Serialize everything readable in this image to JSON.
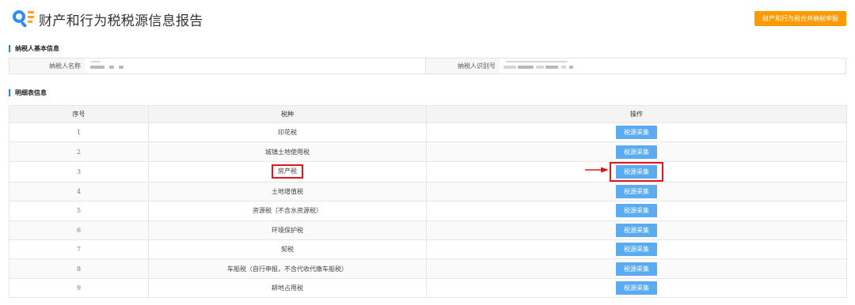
{
  "header": {
    "title": "财产和行为税税源信息报告",
    "combined_button_label": "财产和行为税合并纳税申报",
    "colors": {
      "accent_orange": "#ff9a00",
      "logo_blue": "#2b8ef0",
      "logo_orange": "#ffa21a"
    }
  },
  "basic_info": {
    "section_title": "纳税人基本信息",
    "name_label": "纳税人名称",
    "id_label": "纳税人识别号"
  },
  "detail": {
    "section_title": "明细表信息",
    "columns": [
      "序号",
      "税种",
      "操作"
    ],
    "rows": [
      {
        "no": "1",
        "tax": "印花税",
        "action": "税源采集"
      },
      {
        "no": "2",
        "tax": "城镇土地使用税",
        "action": "税源采集"
      },
      {
        "no": "3",
        "tax": "房产税",
        "action": "税源采集",
        "highlighted": true
      },
      {
        "no": "4",
        "tax": "土地增值税",
        "action": "税源采集"
      },
      {
        "no": "5",
        "tax": "资源税（不含水资源税）",
        "action": "税源采集"
      },
      {
        "no": "6",
        "tax": "环境保护税",
        "action": "税源采集"
      },
      {
        "no": "7",
        "tax": "契税",
        "action": "税源采集"
      },
      {
        "no": "8",
        "tax": "车船税（自行申报，不含代收代缴车船税）",
        "action": "税源采集"
      },
      {
        "no": "9",
        "tax": "耕地占用税",
        "action": "税源采集"
      }
    ],
    "colors": {
      "button_blue": "#5aabf0",
      "highlight_red": "#e0161c"
    }
  }
}
